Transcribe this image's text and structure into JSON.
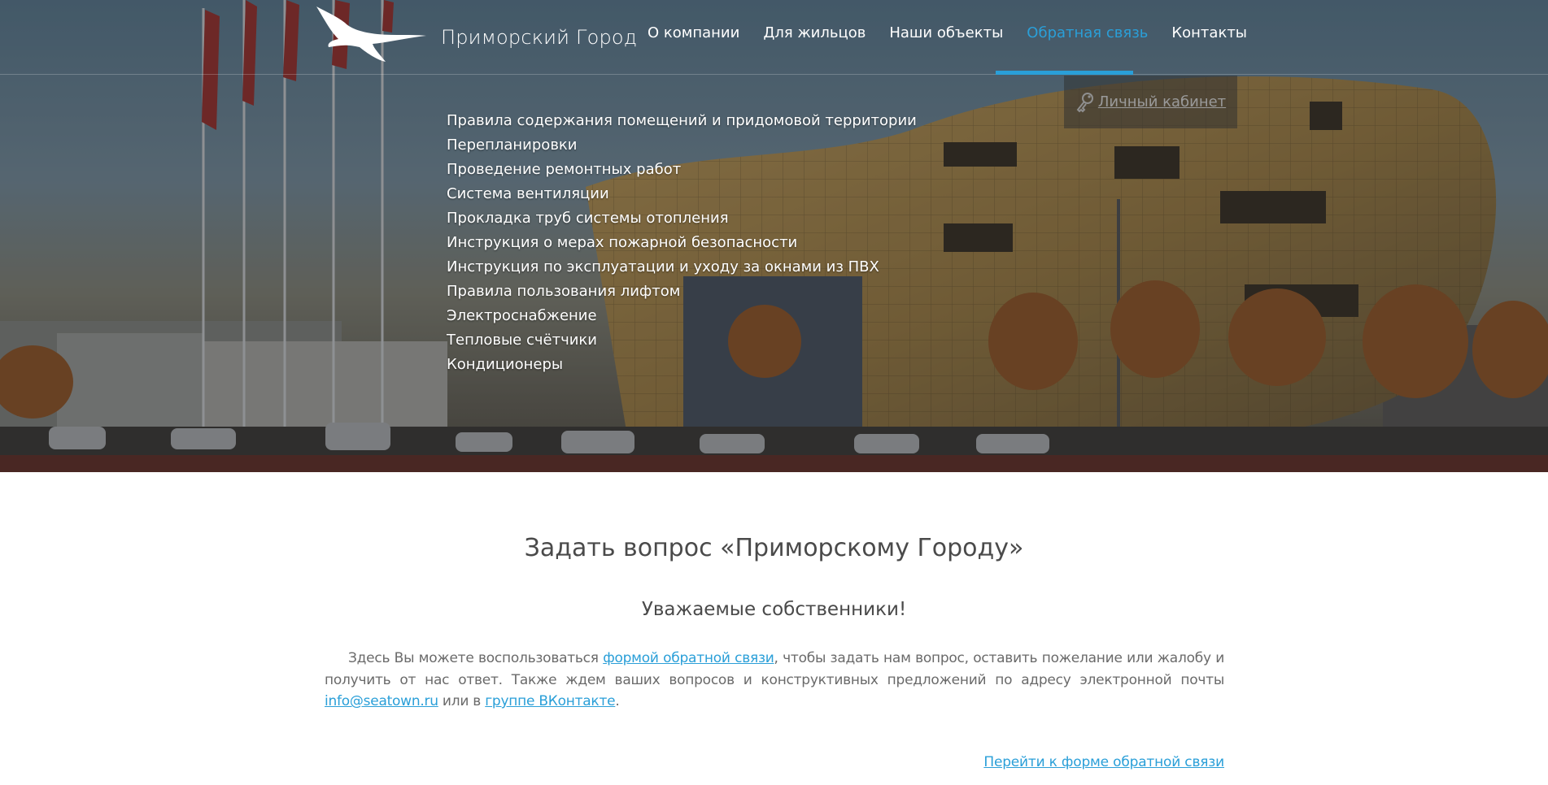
{
  "header": {
    "logo_text": "Приморский Город",
    "nav": [
      {
        "label": "О компании"
      },
      {
        "label": "Для жильцов"
      },
      {
        "label": "Наши объекты"
      },
      {
        "label": "Обратная связь",
        "active": true
      },
      {
        "label": "Контакты"
      }
    ],
    "cabinet_label": "Личный кабинет"
  },
  "submenu": [
    "Правила содержания помещений и придомовой территории",
    "Перепланировки",
    "Проведение ремонтных работ",
    "Система вентиляции",
    "Прокладка труб системы отопления",
    "Инструкция о мерах пожарной безопасности",
    "Инструкция по эксплуатации и уходу за окнами из ПВХ",
    "Правила пользования лифтом",
    "Электроснабжение",
    "Тепловые счётчики",
    "Кондиционеры"
  ],
  "content": {
    "title": "Задать вопрос «Приморскому Городу»",
    "subtitle": "Уважаемые собственники!",
    "intro_part1": "Здесь Вы можете воспользоваться ",
    "intro_link_form": "формой обратной связи",
    "intro_part2": ", чтобы задать нам вопрос, оставить пожелание или жалобу и получить от нас ответ. Также ждем ваших вопросов и конструктивных предложений по адресу электронной почты ",
    "intro_link_email": "info@seatown.ru",
    "intro_part3": " или в ",
    "intro_link_vk": "группе ВКонтакте",
    "intro_part4": ".",
    "feedback_link": "Перейти к форме обратной связи"
  },
  "colors": {
    "accent": "#2a9fd8",
    "text": "#4a4a4a"
  },
  "icons": {
    "logo": "seagull-logo",
    "cabinet": "key-icon"
  }
}
